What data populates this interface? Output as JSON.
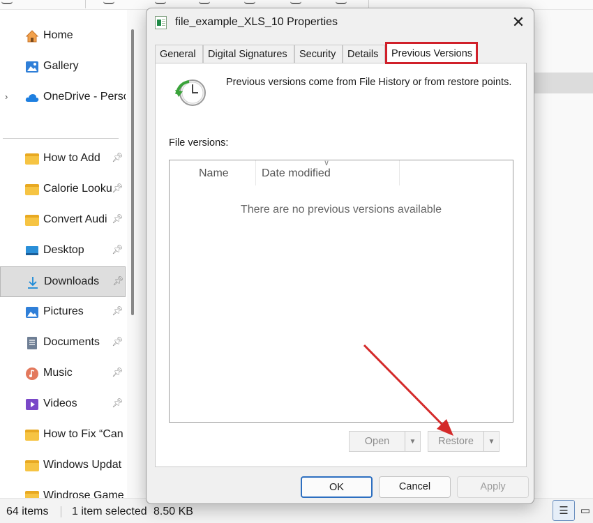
{
  "sidebar": {
    "items": [
      {
        "label": "Home",
        "icon": "home-icon",
        "pinned": false
      },
      {
        "label": "Gallery",
        "icon": "gallery-icon",
        "pinned": false
      },
      {
        "label": "OneDrive - Perso",
        "icon": "onedrive-cloud-icon",
        "pinned": false,
        "expandable": true
      },
      {
        "label": "How to Add",
        "icon": "folder-icon",
        "pinned": true
      },
      {
        "label": "Calorie Looku",
        "icon": "folder-icon",
        "pinned": true
      },
      {
        "label": "Convert Audi",
        "icon": "folder-icon",
        "pinned": true
      },
      {
        "label": "Desktop",
        "icon": "desktop-icon",
        "pinned": true
      },
      {
        "label": "Downloads",
        "icon": "download-icon",
        "pinned": true,
        "selected": true
      },
      {
        "label": "Pictures",
        "icon": "pictures-icon",
        "pinned": true
      },
      {
        "label": "Documents",
        "icon": "documents-icon",
        "pinned": true
      },
      {
        "label": "Music",
        "icon": "music-icon",
        "pinned": true
      },
      {
        "label": "Videos",
        "icon": "videos-icon",
        "pinned": true
      },
      {
        "label": "How to Fix “Can",
        "icon": "folder-icon",
        "pinned": false
      },
      {
        "label": "Windows Updat",
        "icon": "folder-icon",
        "pinned": false
      },
      {
        "label": "Windrose Game",
        "icon": "folder-icon",
        "pinned": false
      }
    ]
  },
  "statusbar": {
    "item_count": "64 items",
    "selection": "1 item selected",
    "size": "8.50 KB"
  },
  "dialog": {
    "title": "file_example_XLS_10 Properties",
    "close_label": "✕",
    "tabs": [
      "General",
      "Digital Signatures",
      "Security",
      "Details",
      "Previous Versions"
    ],
    "active_tab": "Previous Versions",
    "description": "Previous versions come from File History or from restore points.",
    "file_versions_label": "File versions:",
    "columns": [
      "Name",
      "Date modified"
    ],
    "empty_message": "There are no previous versions available",
    "open_label": "Open",
    "restore_label": "Restore",
    "ok_label": "OK",
    "cancel_label": "Cancel",
    "apply_label": "Apply"
  },
  "colors": {
    "highlight_box": "#d0202a",
    "annotation_arrow": "#d42a2a",
    "default_button_border": "#2d6fc0"
  }
}
